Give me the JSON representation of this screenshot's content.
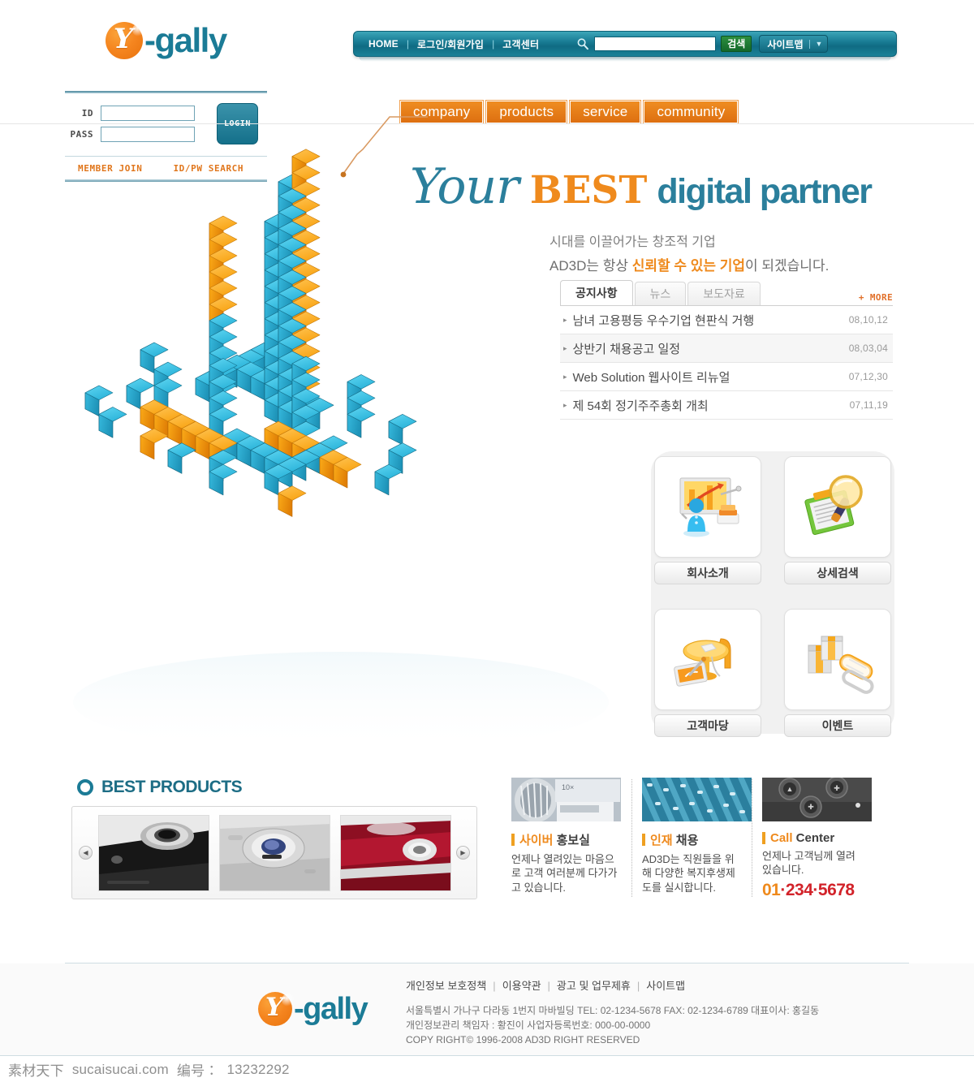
{
  "brand": {
    "name": "gally",
    "prefix_glyph": "Y",
    "separator": "-"
  },
  "topnav": {
    "links": [
      "HOME",
      "로그인/회원가입",
      "고객센터"
    ],
    "separator": "|",
    "search": {
      "value": "",
      "placeholder": "",
      "button_label": "검색",
      "icon": "search-icon"
    },
    "sitemap": {
      "label": "사이트맵",
      "caret": "▼"
    }
  },
  "login": {
    "id_label": "ID",
    "pass_label": "PASS",
    "id_value": "",
    "pass_value": "",
    "submit_label": "LOGIN",
    "links": [
      "MEMBER JOIN",
      "ID/PW SEARCH"
    ]
  },
  "mainmenu": {
    "items": [
      "company",
      "products",
      "service",
      "community"
    ]
  },
  "hero": {
    "word_your": "Your",
    "word_best": "BEST",
    "word_rest": "digital partner",
    "sub1": "시대를 이끌어가는 창조적 기업",
    "sub2_pre": "AD3D는 항상 ",
    "sub2_hl": "신뢰할 수 있는 기업",
    "sub2_post": "이 되겠습니다."
  },
  "board": {
    "tabs": [
      {
        "label": "공지사항",
        "active": true
      },
      {
        "label": "뉴스",
        "active": false
      },
      {
        "label": "보도자료",
        "active": false
      }
    ],
    "more_label": "+ MORE",
    "bullet": "▸",
    "rows": [
      {
        "title": "남녀 고용평등 우수기업 현판식 거행",
        "date": "08,10,12"
      },
      {
        "title": "상반기 채용공고 일정",
        "date": "08,03,04"
      },
      {
        "title": "Web Solution 웹사이트 리뉴얼",
        "date": "07,12,30"
      },
      {
        "title": "제 54회 정기주주총회 개최",
        "date": "07,11,19"
      }
    ]
  },
  "quickmenu": {
    "items": [
      {
        "label": "회사소개",
        "icon": "presentation-chart-icon"
      },
      {
        "label": "상세검색",
        "icon": "magnifier-document-icon"
      },
      {
        "label": "고객마당",
        "icon": "table-chair-icon"
      },
      {
        "label": "이벤트",
        "icon": "gift-box-icon"
      }
    ]
  },
  "best_products": {
    "title": "BEST PRODUCTS",
    "prev_label": "◀",
    "next_label": "▶",
    "items": [
      "product-black-phone",
      "product-silver-phone",
      "product-red-phone"
    ]
  },
  "info_boxes": [
    {
      "thumb": "camera-lens-photo",
      "head_hl": "사이버",
      "head_rest": " 홍보실",
      "body": "언제나 열려있는 마음으로 고객 여러분께 다가가고 있습니다."
    },
    {
      "thumb": "blue-keyboard-photo",
      "head_hl": "인재",
      "head_rest": " 채용",
      "body": "AD3D는 직원들을 위해 다양한 복지후생제도를 실시합니다."
    },
    {
      "thumb": "control-buttons-photo",
      "head_hl": "Call",
      "head_rest": " Center",
      "body": "언제나 고객님께 열려있습니다.",
      "tel_prefix": "01",
      "tel_rest": "·234·5678"
    }
  ],
  "footer": {
    "links": [
      "개인정보 보호정책",
      "이용약관",
      "광고 및 업무제휴",
      "사이트맵"
    ],
    "separator": "|",
    "address_line1": "서울특별시 가나구 다라동  1번지 마바빌딩  TEL: 02-1234-5678   FAX: 02-1234-6789    대표이사: 홍길동",
    "address_line2": "개인정보관리 책임자 : 황진이  사업자등록번호: 000-00-0000",
    "copyright": "COPY RIGHT© 1996-2008 AD3D RIGHT RESERVED"
  },
  "watermark": {
    "site_cn": "素材天下",
    "site": "sucaisucai.com",
    "id_label": "编号：",
    "id_value": "13232292"
  },
  "colors": {
    "teal": "#1b7b96",
    "orange": "#ef8a1d",
    "cube_blue": "#2ba8cc",
    "cube_orange": "#f29100",
    "nav_bg": "#14708a",
    "red": "#d2232a"
  }
}
